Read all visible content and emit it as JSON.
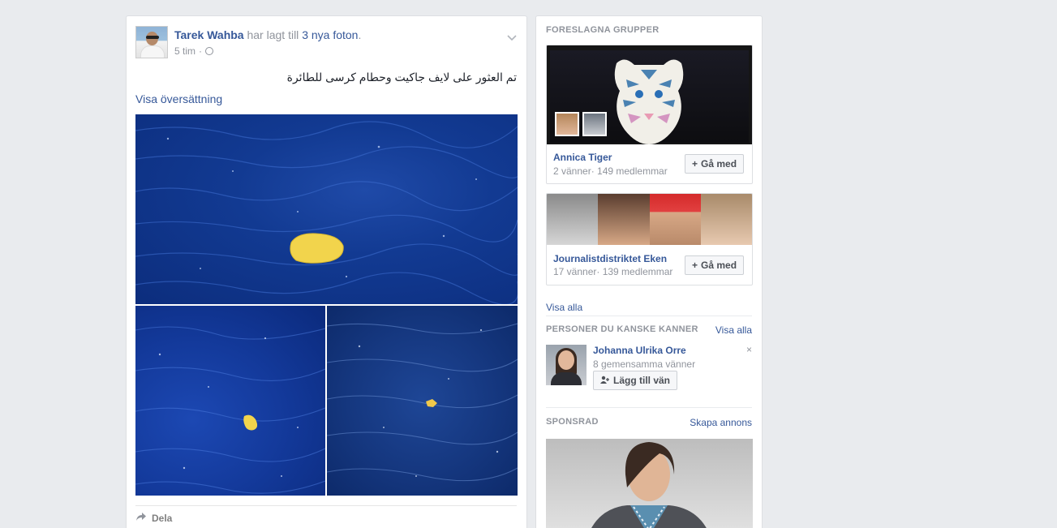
{
  "post": {
    "author": "Tarek Wahba",
    "action_text": " har lagt till ",
    "photos_link": "3 nya foton",
    "action_end": ".",
    "time": "5 tim",
    "separator": "·",
    "text": "تم العثور على لايف جاكيت وحطام كرسى للطائرة",
    "translate_label": "Visa översättning",
    "share_label": "Dela",
    "colors": {
      "link": "#365899",
      "sea": "#123a92",
      "debris": "#f2d44c"
    }
  },
  "sidebar": {
    "groups_title": "FORESLAGNA GRUPPER",
    "groups": [
      {
        "name": "Annica Tiger",
        "meta": "2 vänner· 149 medlemmar",
        "join_label": "Gå med"
      },
      {
        "name": "Journalistdistriktet Eken",
        "meta": "17 vänner· 139 medlemmar",
        "join_label": "Gå med"
      }
    ],
    "groups_see_all": "Visa alla",
    "people_title": "PERSONER DU KANSKE KANNER",
    "people_see_all": "Visa alla",
    "person": {
      "name": "Johanna Ulrika Orre",
      "mutual": "8 gemensamma vänner",
      "add_label": "Lägg till vän",
      "close": "×"
    },
    "sponsored_title": "SPONSRAD",
    "create_ad": "Skapa annons"
  },
  "icons": [
    "globe-icon",
    "chevron-down-icon",
    "share-arrow-icon",
    "plus-icon",
    "add-friend-icon",
    "close-icon"
  ]
}
